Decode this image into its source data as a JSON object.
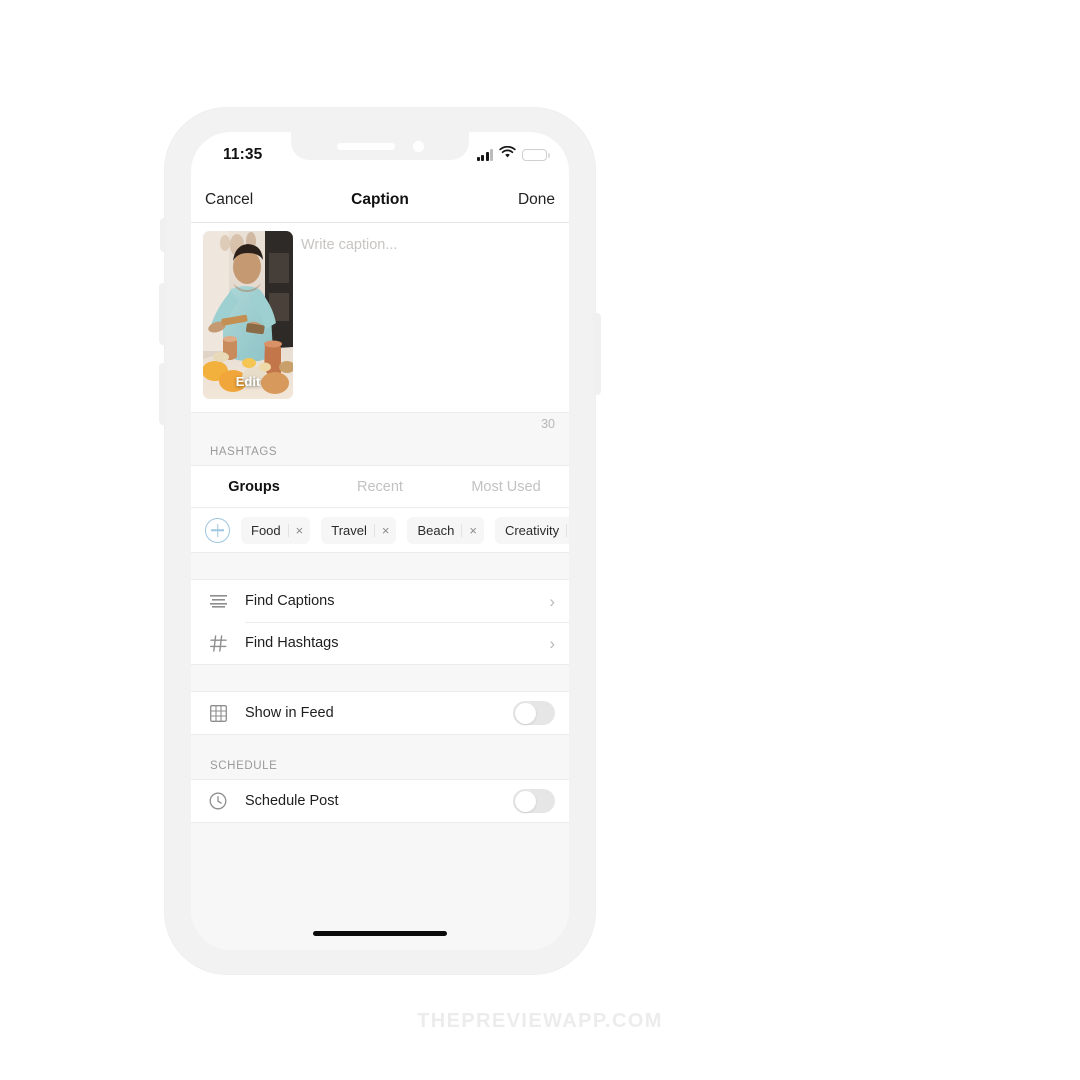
{
  "statusbar": {
    "time": "11:35",
    "signal_icon": "cellular-signal-icon",
    "wifi_icon": "wifi-icon",
    "battery_icon": "battery-icon"
  },
  "navbar": {
    "cancel_label": "Cancel",
    "title": "Caption",
    "done_label": "Done"
  },
  "caption": {
    "placeholder": "Write caption...",
    "value": "",
    "edit_label": "Edit",
    "counter": "30"
  },
  "hashtags": {
    "section_label": "HASHTAGS",
    "tabs": [
      {
        "label": "Groups",
        "active": true
      },
      {
        "label": "Recent",
        "active": false
      },
      {
        "label": "Most Used",
        "active": false
      }
    ],
    "add_icon": "plus-circle-icon",
    "chips": [
      {
        "label": "Food",
        "remove": "×"
      },
      {
        "label": "Travel",
        "remove": "×"
      },
      {
        "label": "Beach",
        "remove": "×"
      },
      {
        "label": "Creativity",
        "remove": "×"
      }
    ]
  },
  "actions": [
    {
      "label": "Find Captions",
      "icon": "list-lines-icon",
      "accessory": "›"
    },
    {
      "label": "Find Hashtags",
      "icon": "hash-icon",
      "accessory": "›"
    }
  ],
  "feed": {
    "label": "Show in Feed",
    "icon": "grid-icon",
    "toggle_on": false
  },
  "schedule": {
    "section_label": "SCHEDULE",
    "label": "Schedule Post",
    "icon": "clock-icon",
    "toggle_on": false
  },
  "watermark": "THEPREVIEWAPP.COM",
  "colors": {
    "accent": "#9ec6e0",
    "battery": "#f5c518",
    "screen_bg": "#f7f7f7",
    "card_bg": "#ffffff"
  }
}
